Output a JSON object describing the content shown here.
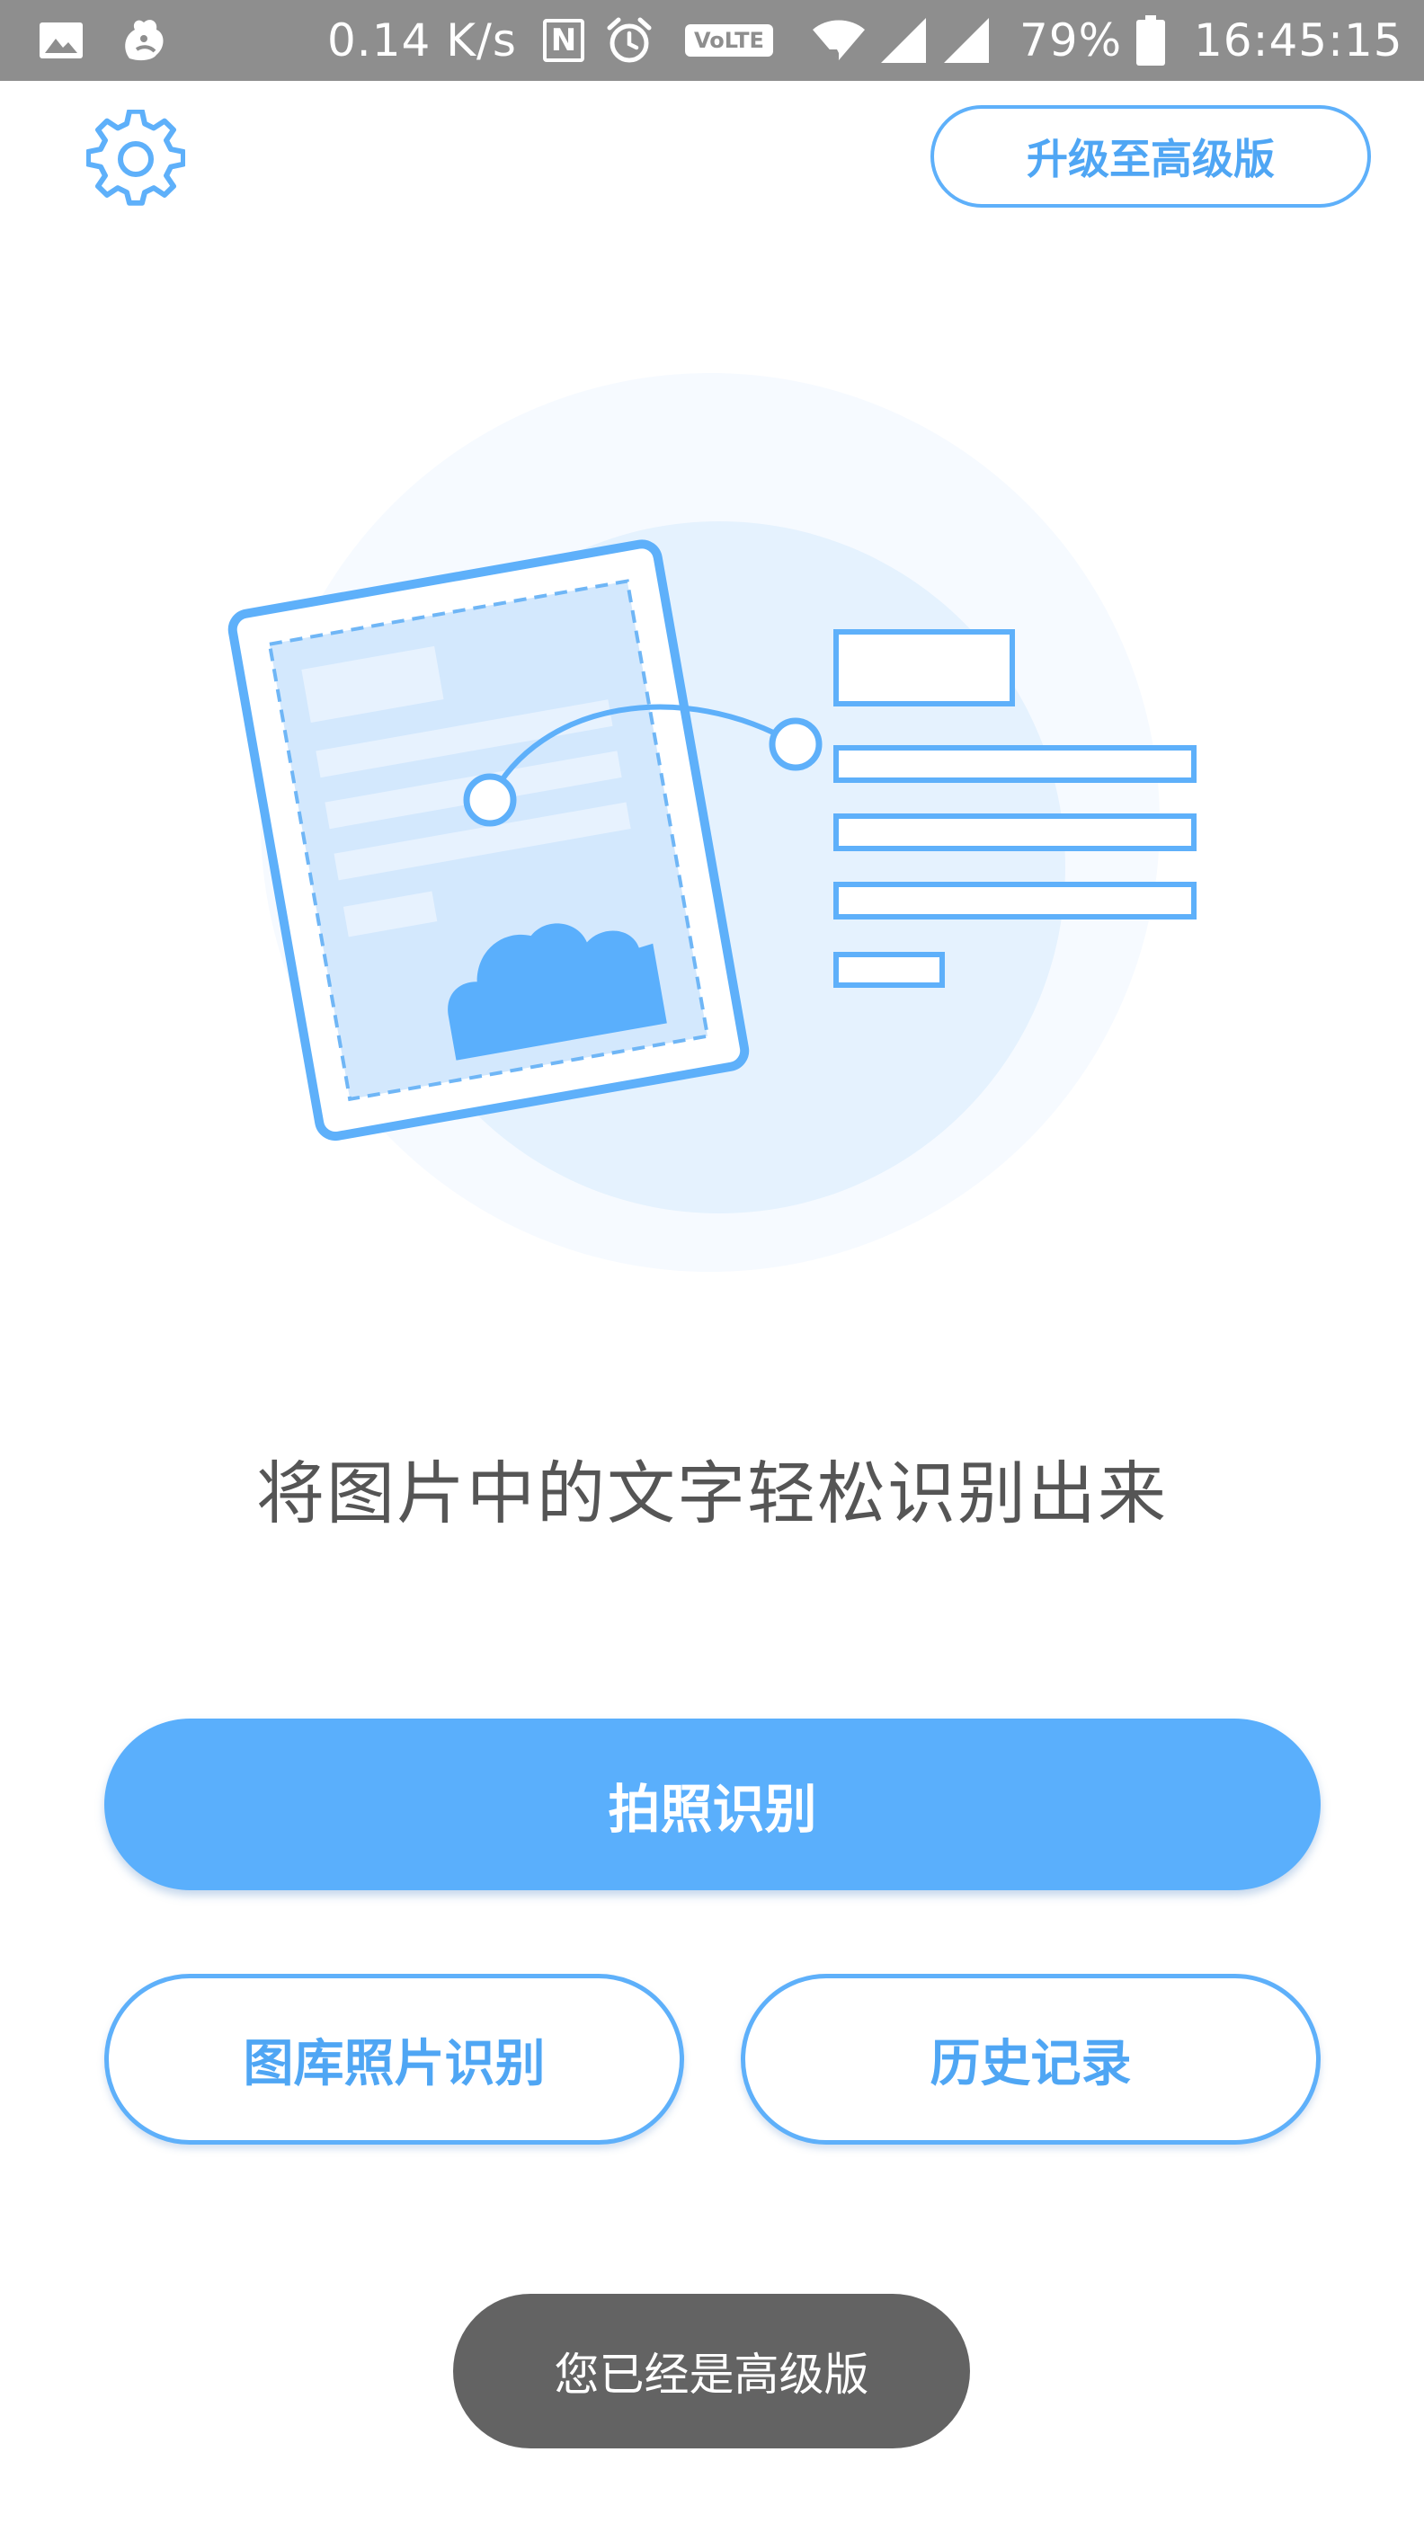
{
  "status_bar": {
    "net_speed": "0.14 K/s",
    "nfc_letter": "N",
    "volte": "VoLTE",
    "battery": "79%",
    "time": "16:45:15",
    "icons": [
      "gallery-icon",
      "squirrel-app-icon",
      "nfc-icon",
      "alarm-icon",
      "volte-icon",
      "wifi-icon",
      "signal-icon",
      "signal-icon",
      "battery-icon"
    ]
  },
  "top_bar": {
    "settings_icon": "gear-icon",
    "upgrade_label": "升级至高级版"
  },
  "hero": {
    "illustration": "document-to-text-icon"
  },
  "headline": "将图片中的文字轻松识别出来",
  "actions": {
    "camera_label": "拍照识别",
    "gallery_label": "图库照片识别",
    "history_label": "历史记录"
  },
  "toast": "您已经是高级版",
  "colors": {
    "accent": "#5aaffc",
    "accent_text": "#4fa6f4",
    "status_bar": "#8e8e8e",
    "toast": "#636363",
    "headline_text": "#555555"
  }
}
